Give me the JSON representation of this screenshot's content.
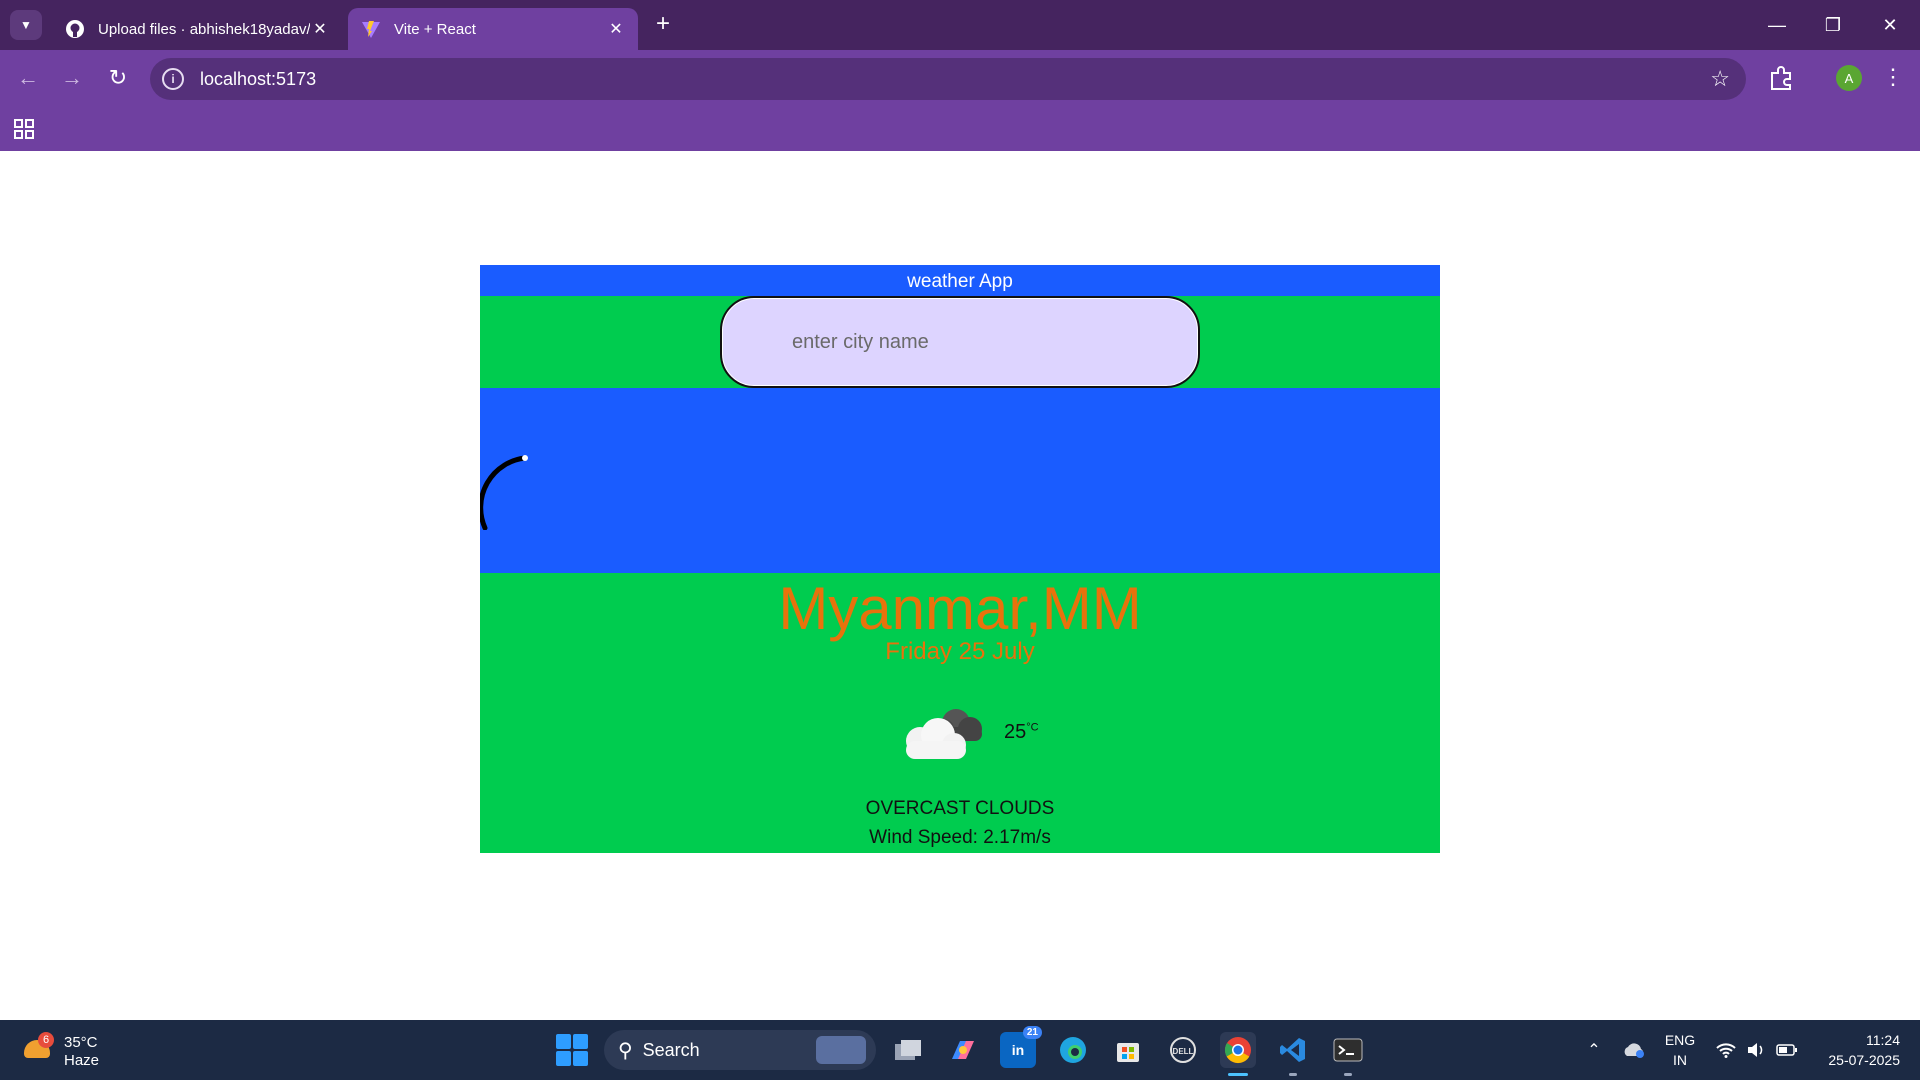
{
  "browser": {
    "tabs": [
      {
        "title": "Upload files · abhishek18yadav/",
        "active": false
      },
      {
        "title": "Vite + React",
        "active": true
      }
    ],
    "url": "localhost:5173",
    "avatar_letter": "A",
    "accent_color": "#6f40a0",
    "frame_color": "#45245f"
  },
  "app": {
    "header_title": "weather App",
    "search": {
      "placeholder": "enter city name",
      "value": ""
    },
    "city": "Myanmar,MM",
    "date": "Friday 25 July",
    "weather_icon": "cloud-icon",
    "temperature": "25",
    "temperature_unit": "°C",
    "description": "OVERCAST CLOUDS",
    "wind_speed": "Wind Speed: 2.17m/s",
    "colors": {
      "header_blue": "#1a5cff",
      "band_green": "#00cc4f",
      "city_orange": "#e8720c",
      "input_bg": "#ddd4ff"
    }
  },
  "taskbar": {
    "weather": {
      "temp": "35°C",
      "condition": "Haze",
      "badge": "6"
    },
    "search_label": "Search",
    "apps": [
      {
        "name": "task-view",
        "icon": "task-view-icon"
      },
      {
        "name": "copilot",
        "icon": "copilot-icon"
      },
      {
        "name": "linkedin",
        "icon": "linkedin-icon",
        "badge": "21"
      },
      {
        "name": "edge",
        "icon": "edge-icon"
      },
      {
        "name": "store",
        "icon": "store-icon"
      },
      {
        "name": "dell",
        "icon": "dell-icon"
      },
      {
        "name": "chrome",
        "icon": "chrome-icon",
        "active": true
      },
      {
        "name": "vscode",
        "icon": "vscode-icon"
      },
      {
        "name": "terminal",
        "icon": "terminal-icon"
      }
    ],
    "language": {
      "line1": "ENG",
      "line2": "IN"
    },
    "time": "11:24",
    "date": "25-07-2025"
  }
}
